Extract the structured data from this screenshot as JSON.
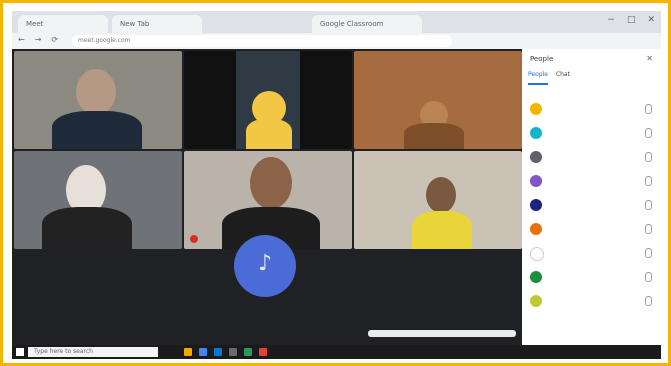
{
  "browser": {
    "tabs": [
      "Meet",
      "New Tab",
      "Google Classroom"
    ],
    "url": "meet.google.com",
    "window_controls": [
      "−",
      "□",
      "✕"
    ]
  },
  "meeting": {
    "tiles": [
      {
        "name": "",
        "colors": {
          "bg": "#8d8a82",
          "head": "#b49a85",
          "shirt": "#1f2a3a"
        }
      },
      {
        "name": "",
        "colors": {
          "bg": "#2f3a44",
          "head": "#f2c744",
          "shirt": "#f2c744"
        }
      },
      {
        "name": "",
        "colors": {
          "bg": "#a66c3f",
          "head": "#b98353",
          "shirt": "#7f4f2a"
        }
      },
      {
        "name": "",
        "colors": {
          "bg": "#6f7378",
          "head": "#e6e0d8",
          "shirt": "#222"
        }
      },
      {
        "name": "",
        "colors": {
          "bg": "#b9b3aa",
          "head": "#8a6349",
          "shirt": "#1d1d1d"
        }
      },
      {
        "name": "",
        "colors": {
          "bg": "#c9c2b5",
          "head": "#7b5840",
          "shirt": "#e7d53a"
        }
      }
    ],
    "presenter_letter": "♪"
  },
  "panel": {
    "title": "People",
    "close": "✕",
    "tabs": [
      "People",
      "Chat"
    ],
    "participants": [
      {
        "name": "",
        "color": "#f4b400"
      },
      {
        "name": "",
        "color": "#12b5cb"
      },
      {
        "name": "",
        "color": "#5f6368"
      },
      {
        "name": "",
        "color": "#7e57c2"
      },
      {
        "name": "",
        "color": "#1a237e"
      },
      {
        "name": "",
        "color": "#e8710a"
      },
      {
        "name": "",
        "color": "#ffffff"
      },
      {
        "name": "",
        "color": "#1e8e3e"
      },
      {
        "name": "",
        "color": "#c0ca33"
      }
    ]
  },
  "taskbar": {
    "search_placeholder": "Type here to search",
    "time": ""
  }
}
